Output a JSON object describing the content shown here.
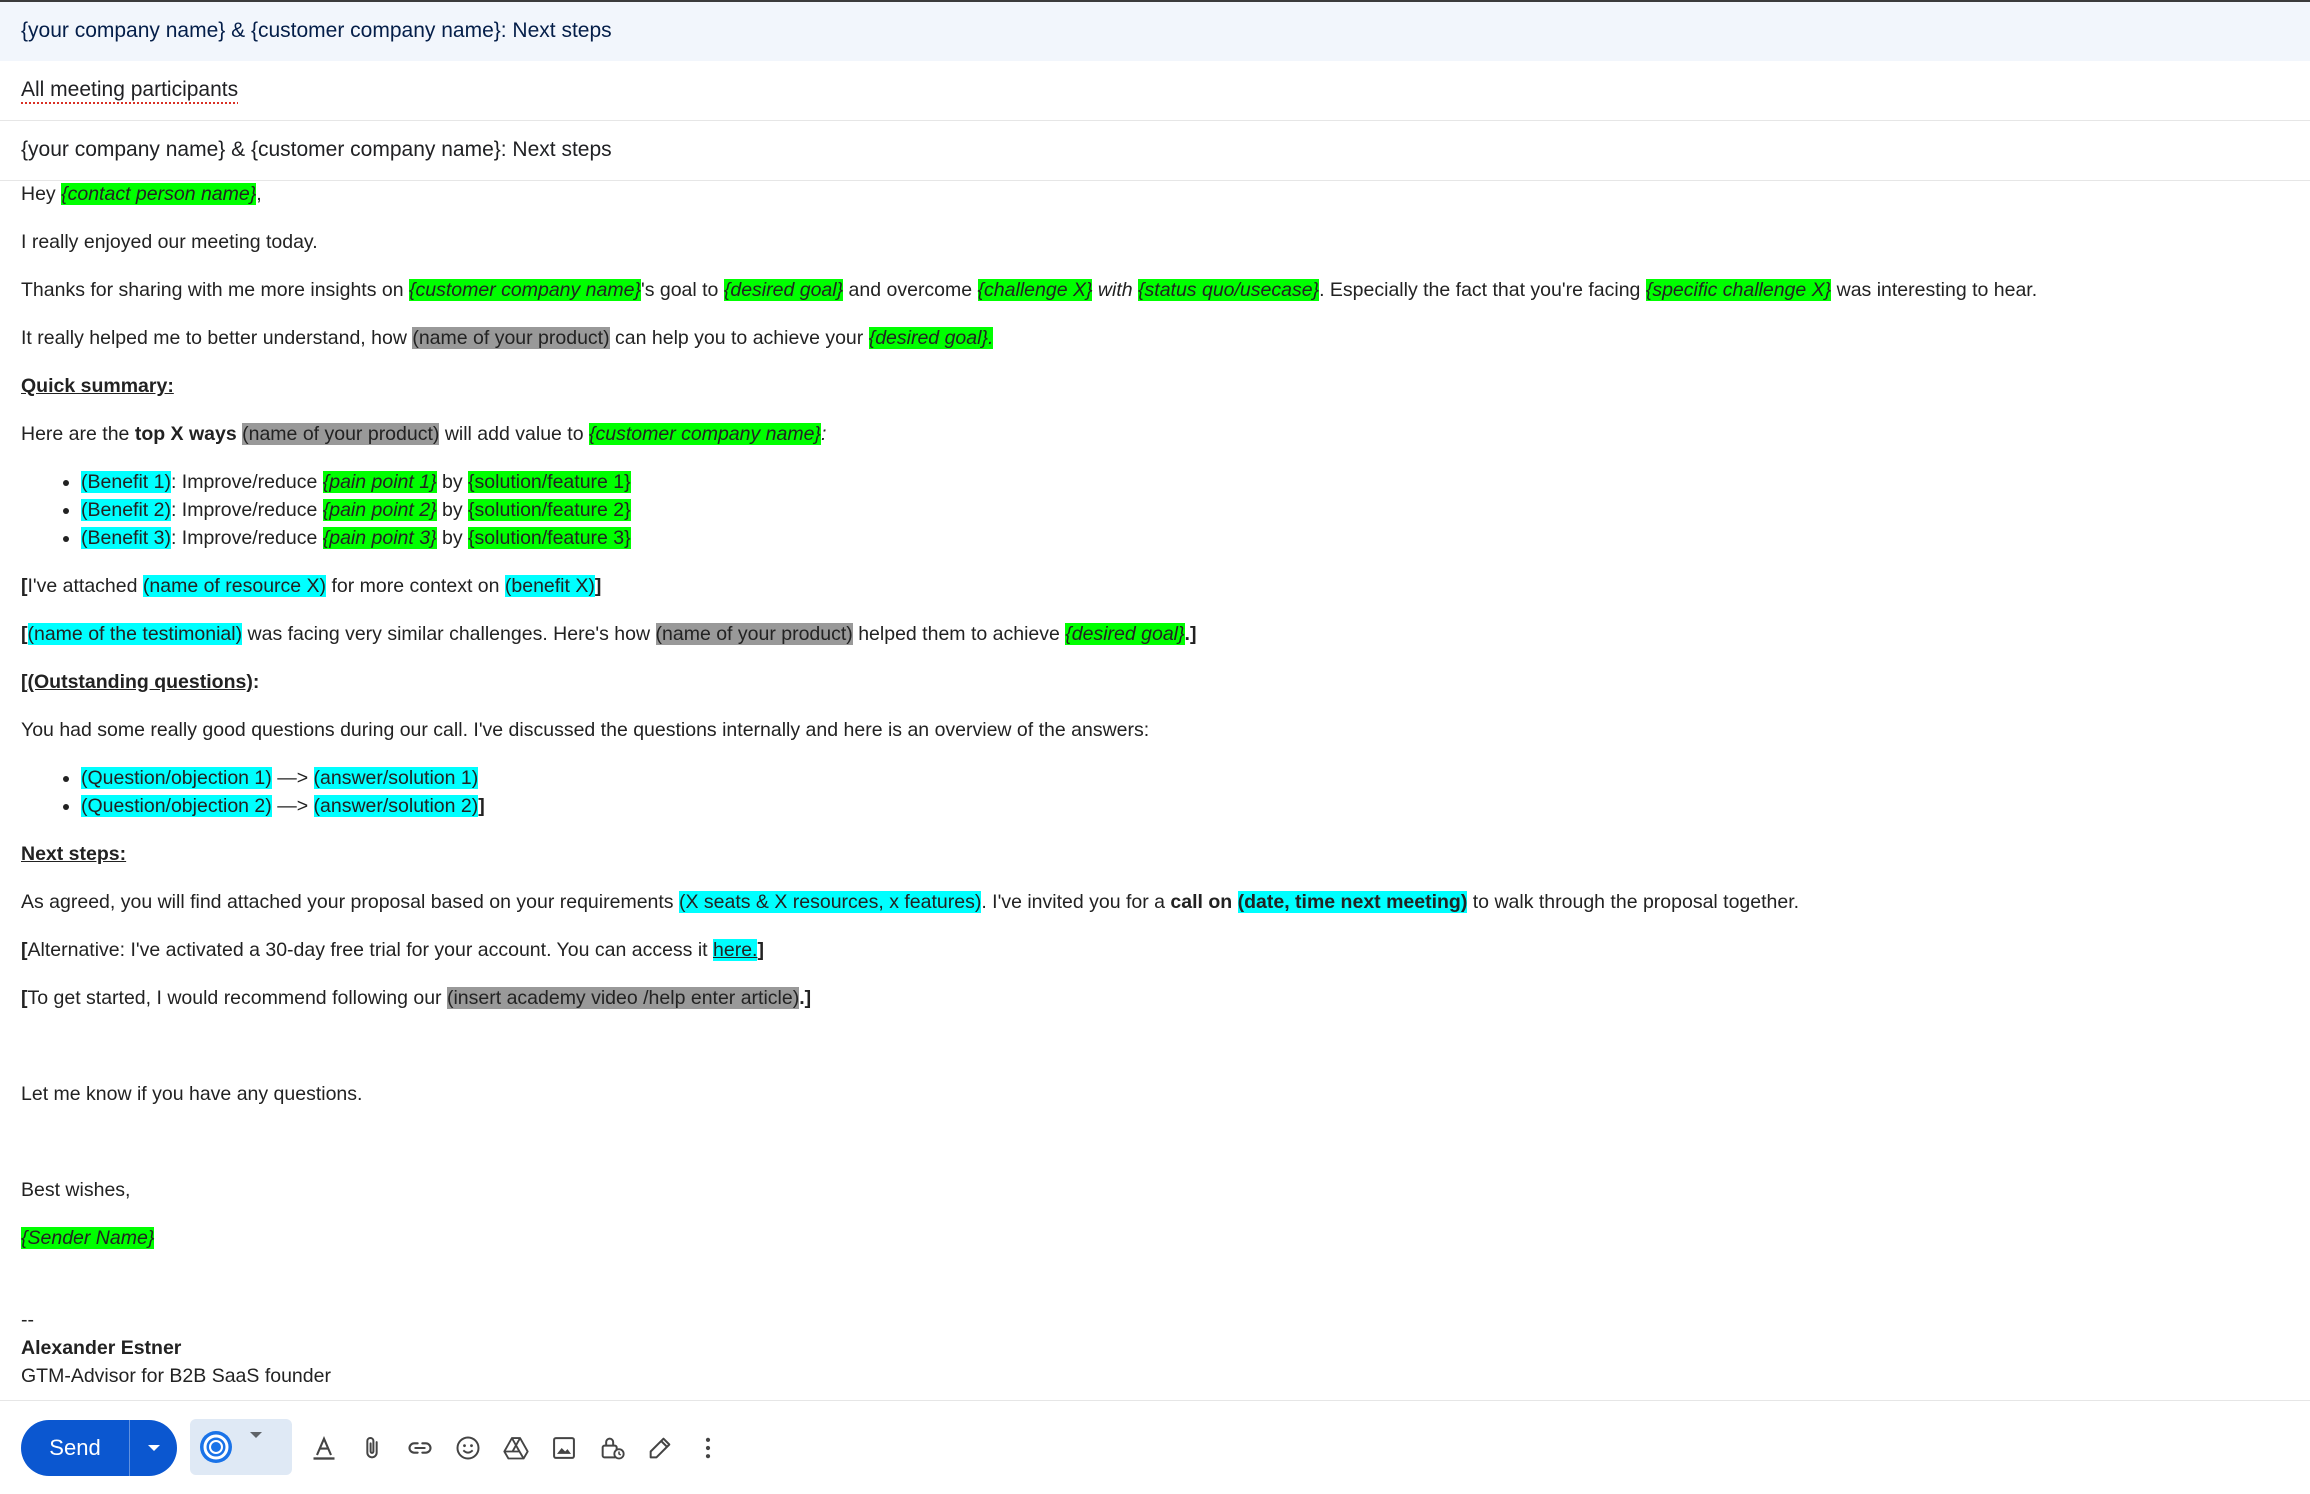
{
  "window": {
    "title": "{your company name} & {customer company name}: Next steps"
  },
  "recipients": {
    "value": "All meeting participants"
  },
  "subject": {
    "value": "{your company name} & {customer company name}: Next steps"
  },
  "email": {
    "greeting": {
      "hey": "Hey",
      "contact": "{contact person name}",
      "comma": ","
    },
    "enjoyed": "I really enjoyed our meeting today.",
    "insights": {
      "a": "Thanks for sharing with me more insights on",
      "customer": "{customer company name}",
      "b": "'s goal to",
      "goal": "{desired goal}",
      "c": "and overcome",
      "challenge": "{challenge X}",
      "with": "with",
      "status": "{status quo/usecase}",
      "d": ". Especially the fact that you're facing",
      "specific": "{specific challenge X}",
      "e": "was interesting to hear."
    },
    "helped": {
      "a": "It really helped me to better understand, how",
      "product": "(name of your product)",
      "b": "can help you to achieve your",
      "goal": "{desired goal}."
    },
    "quick_summary_heading": "Quick summary:",
    "topx": {
      "a": "Here are the",
      "bold": "top X ways",
      "product": "(name of your product)",
      "b": "will add value to",
      "customer": "{customer company name}",
      "colon": ":"
    },
    "benefits": [
      {
        "benefit": "(Benefit 1)",
        "mid": ": Improve/reduce",
        "pain": "{pain point 1}",
        "by": "by",
        "solution": "{solution/feature 1}"
      },
      {
        "benefit": "(Benefit 2)",
        "mid": ": Improve/reduce",
        "pain": "{pain point 2}",
        "by": "by",
        "solution": "{solution/feature 2}"
      },
      {
        "benefit": "(Benefit 3)",
        "mid": ": Improve/reduce",
        "pain": "{pain point 3}",
        "by": "by",
        "solution": "{solution/feature 3}"
      }
    ],
    "attached": {
      "open": "[",
      "a": "I've attached",
      "resource": "(name of resource X)",
      "b": "for more context on",
      "benefit": "(benefit X)",
      "close": "]"
    },
    "testimonial": {
      "open": "[",
      "name": "(name of the testimonial)",
      "a": "was facing very similar challenges. Here's how",
      "product": "(name of your product)",
      "b": "helped them to achieve",
      "goal": "{desired goal}",
      "close": ".]"
    },
    "outstanding": {
      "open": "[",
      "label": "(Outstanding questions)",
      "colon": ":"
    },
    "questions_intro": "You had some really good questions during our call. I've discussed the questions internally and here is an overview of the answers:",
    "questions": [
      {
        "q": "(Question/objection 1)",
        "arrow": "—>",
        "a": "(answer/solution 1)",
        "tail": ""
      },
      {
        "q": "(Question/objection 2)",
        "arrow": "—>",
        "a": "(answer/solution 2)",
        "tail": "]"
      }
    ],
    "next_steps_heading": "Next steps:",
    "agreed": {
      "a": "As agreed, you will find attached your proposal based on your requirements",
      "req": "(X seats & X resources, x features)",
      "b": ". I've invited you for a",
      "call": "call on",
      "date": "(date, time next meeting)",
      "c": "to walk through the proposal together."
    },
    "alternative": {
      "open": "[",
      "a": "Alternative: I've activated a 30-day free trial for your account. You can access it",
      "link": "here.",
      "close": "]"
    },
    "started": {
      "open": "[",
      "a": "To get started, I would recommend following our",
      "article": "(insert academy video /help enter article)",
      "close": ".]"
    },
    "let_me_know": "Let me know if you have any questions.",
    "best_wishes": "Best wishes,",
    "sender": "{Sender Name}",
    "sig_dash": "--",
    "sig_name": "Alexander Estner",
    "sig_title": "GTM-Advisor for B2B SaaS founder"
  },
  "toolbar": {
    "send_label": "Send"
  }
}
